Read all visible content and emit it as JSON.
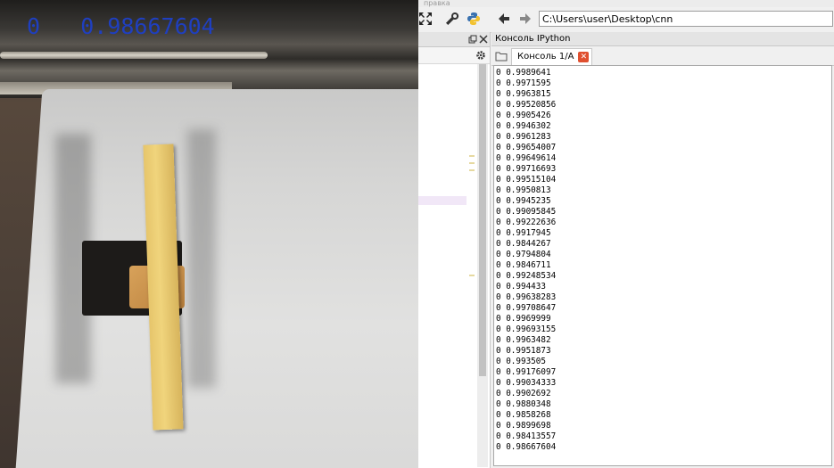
{
  "video": {
    "overlay_class": "0",
    "overlay_score": "0.98667604"
  },
  "ide": {
    "menu_partial": "правка",
    "path": "C:\\Users\\user\\Desktop\\cnn",
    "console_title": "Консоль IPython",
    "console_tab": "Консоль 1/A",
    "icons": [
      "fullscreen-icon",
      "wrench-icon",
      "python-icon",
      "back-arrow-icon",
      "forward-arrow-icon",
      "gear-icon",
      "folder-icon",
      "close-icon"
    ]
  },
  "console": {
    "lines": [
      "0 0.9989641",
      "0 0.9971595",
      "0 0.9963815",
      "0 0.99520856",
      "0 0.9905426",
      "0 0.9946302",
      "0 0.9961283",
      "0 0.99654007",
      "0 0.99649614",
      "0 0.99716693",
      "0 0.99515104",
      "0 0.9950813",
      "0 0.9945235",
      "0 0.99095845",
      "0 0.99222636",
      "0 0.9917945",
      "0 0.9844267",
      "0 0.9794804",
      "0 0.9846711",
      "0 0.99248534",
      "0 0.994433",
      "0 0.99638283",
      "0 0.99708647",
      "0 0.9969999",
      "0 0.99693155",
      "0 0.9963482",
      "0 0.9951873",
      "0 0.993505",
      "0 0.99176097",
      "0 0.99034333",
      "0 0.9902692",
      "0 0.9880348",
      "0 0.9858268",
      "0 0.9899698",
      "0 0.98413557",
      "0 0.98667604"
    ]
  }
}
